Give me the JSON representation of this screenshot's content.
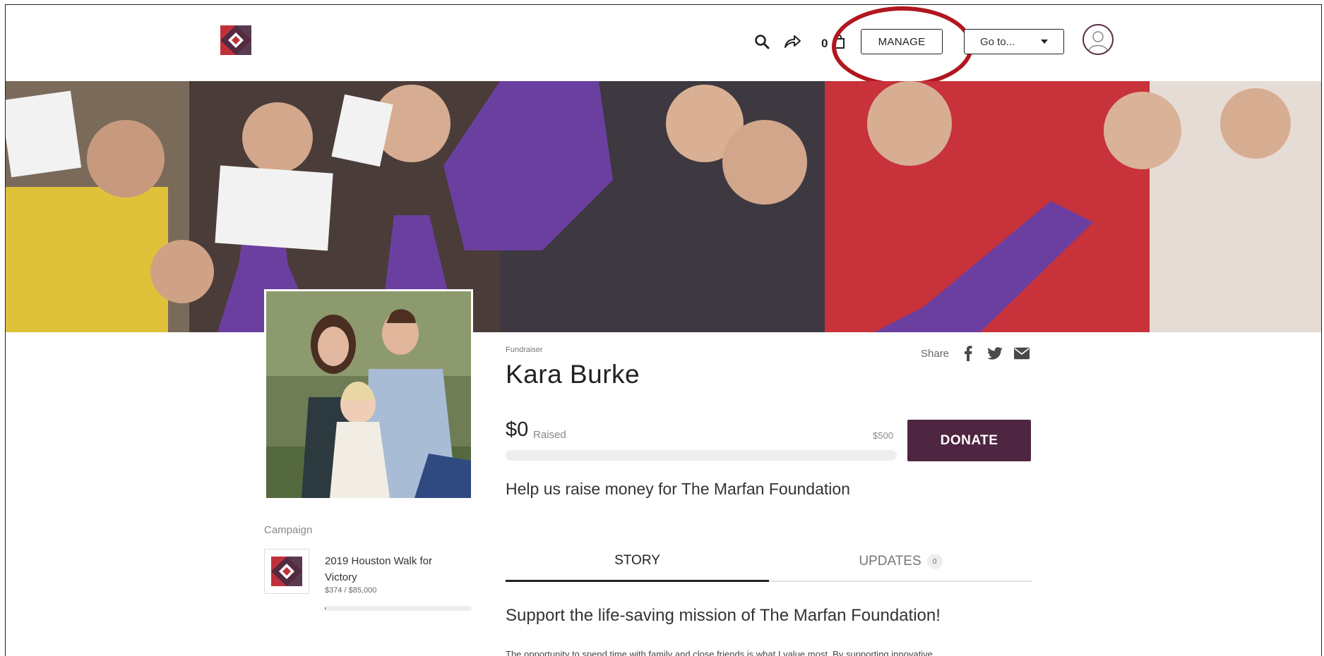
{
  "header": {
    "cart_count": "0",
    "manage_label": "MANAGE",
    "goto_label": "Go to..."
  },
  "colors": {
    "brand_primary": "#4f2641",
    "brand_red": "#b0171f",
    "highlight_annotation": "#b0171f"
  },
  "icons": [
    "logo-icon",
    "search-icon",
    "share-arrow-icon",
    "cart-icon",
    "user-avatar-icon",
    "facebook-icon",
    "twitter-icon",
    "email-icon",
    "caret-down-icon"
  ],
  "fundraiser": {
    "label": "Fundraiser",
    "name": "Kara Burke",
    "share_label": "Share",
    "raised": "$0",
    "raised_label": "Raised",
    "goal": "$500",
    "progress_fraction": 0,
    "donate_label": "DONATE",
    "tagline": "Help us raise money for The Marfan Foundation"
  },
  "campaign": {
    "label": "Campaign",
    "name": "2019 Houston Walk for Victory",
    "amount": "$374 / $85,000",
    "progress_fraction": 0.0044
  },
  "tabs": {
    "story_label": "STORY",
    "updates_label": "UPDATES",
    "updates_count": "0"
  },
  "story": {
    "heading": "Support the life-saving mission of The Marfan Foundation!",
    "text": "The opportunity to spend time with family and close friends is what I value most. By supporting innovative"
  }
}
